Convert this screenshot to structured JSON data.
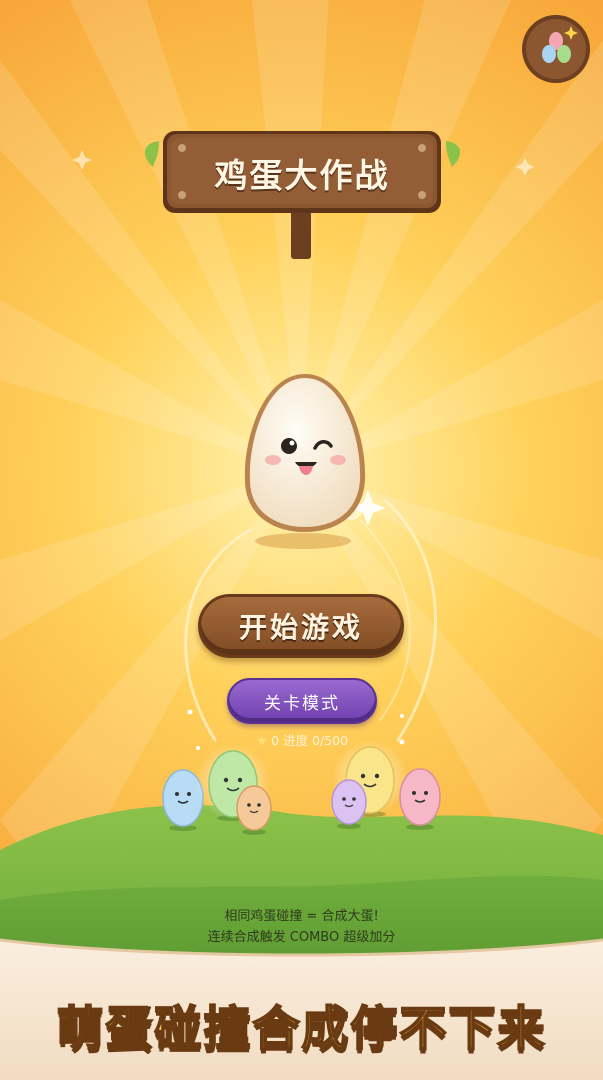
{
  "game": {
    "title": "鸡蛋大作战",
    "start_label": "开始游戏",
    "level_mode_label": "关卡模式",
    "progress_star_count": "0",
    "progress_text": "进度 0/500",
    "hint_line1": "相同鸡蛋碰撞 = 合成大蛋!",
    "hint_line2": "连续合成触发 COMBO 超级加分",
    "banner": "萌蛋碰撞合成停不下来"
  },
  "icons": {
    "top_right": "egg-collection-icon",
    "progress": "star-icon"
  },
  "colors": {
    "background": "#f6a93a",
    "sign_wood": "#7a4a24",
    "start_button": "#8e5a2e",
    "level_button": "#7b4bbf",
    "grass": "#5f9e34",
    "banner_text": "#ffd54a"
  }
}
